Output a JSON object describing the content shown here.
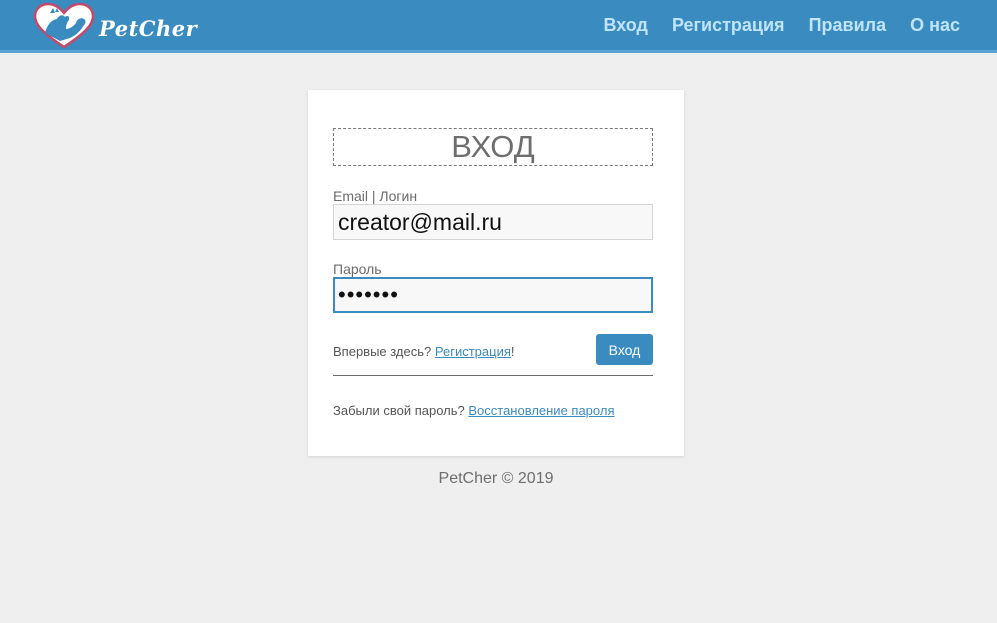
{
  "header": {
    "logo_text": "PetCher",
    "nav": [
      {
        "label": "Вход"
      },
      {
        "label": "Регистрация"
      },
      {
        "label": "Правила"
      },
      {
        "label": "О нас"
      }
    ]
  },
  "login_form": {
    "title": "ВХОД",
    "email_label": "Email | Логин",
    "email_value": "creator@mail.ru",
    "password_label": "Пароль",
    "password_value": "•••••••",
    "first_time_text": "Впервые здесь?",
    "register_link": "Регистрация",
    "register_suffix": "!",
    "submit_label": "Вход",
    "forgot_text": "Забыли свой пароль?",
    "restore_link": "Восстановление пароля"
  },
  "footer": {
    "text": "PetCher © 2019"
  },
  "colors": {
    "header_bg": "#3a8bbf",
    "nav_text": "#bfe4fb",
    "page_bg": "#efefef",
    "button_bg": "#3a8bbf",
    "link": "#3a8bbf"
  }
}
